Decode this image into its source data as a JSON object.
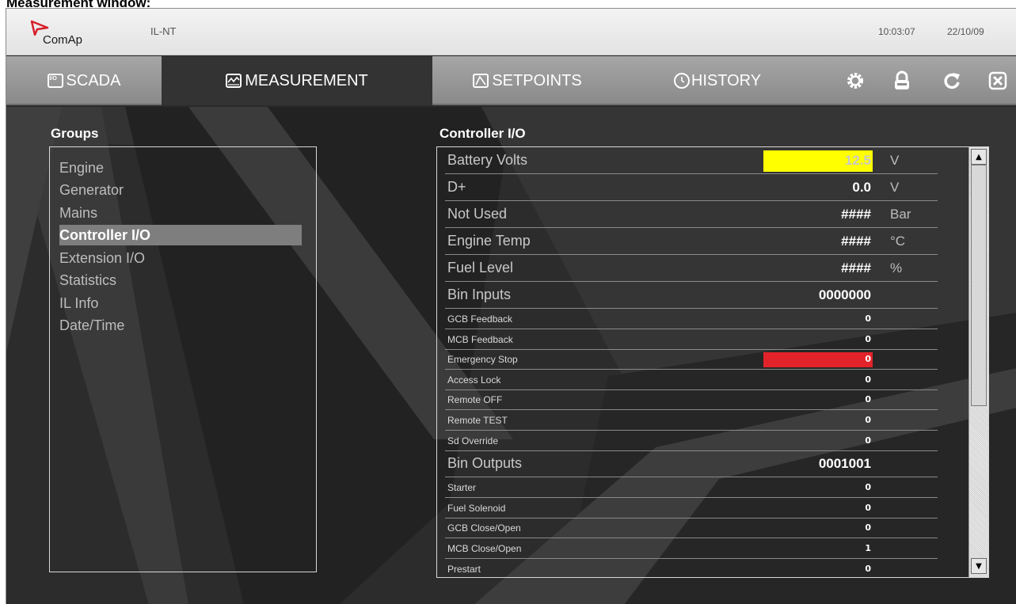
{
  "caption": "Measurement window:",
  "header": {
    "brand": "ComAp",
    "device": "IL-NT",
    "time": "10:03:07",
    "date": "22/10/09"
  },
  "tabs": [
    {
      "label": "SCADA",
      "icon": "scada-icon"
    },
    {
      "label": "MEASUREMENT",
      "icon": "measurement-icon",
      "active": true
    },
    {
      "label": "SETPOINTS",
      "icon": "setpoints-icon"
    },
    {
      "label": "HISTORY",
      "icon": "history-icon"
    }
  ],
  "toolbar": [
    "settings-gear-icon",
    "lock-icon",
    "refresh-icon",
    "close-icon"
  ],
  "groups": {
    "title": "Groups",
    "items": [
      "Engine",
      "Generator",
      "Mains",
      "Controller I/O",
      "Extension I/O",
      "Statistics",
      "IL Info",
      "Date/Time"
    ],
    "selected": "Controller I/O"
  },
  "io": {
    "title": "Controller I/O",
    "rows": [
      {
        "label": "Battery Volts",
        "value": "12.5",
        "unit": "V",
        "highlight": "#ffff00",
        "valueColor": "#c8c8c8"
      },
      {
        "label": "D+",
        "value": "0.0",
        "unit": "V"
      },
      {
        "label": "Not Used",
        "value": "####",
        "unit": "Bar"
      },
      {
        "label": "Engine Temp",
        "value": "####",
        "unit": "°C"
      },
      {
        "label": "Fuel Level",
        "value": "####",
        "unit": "%"
      },
      {
        "label": "Bin Inputs",
        "value": "0000000",
        "unit": ""
      },
      {
        "label": "GCB Feedback",
        "value": "0"
      },
      {
        "label": "MCB Feedback",
        "value": "0"
      },
      {
        "label": "Emergency Stop",
        "value": "0",
        "highlight": "#e3232a"
      },
      {
        "label": "Access Lock",
        "value": "0"
      },
      {
        "label": "Remote OFF",
        "value": "0"
      },
      {
        "label": "Remote TEST",
        "value": "0"
      },
      {
        "label": "Sd Override",
        "value": "0"
      },
      {
        "label": "Bin Outputs",
        "value": "0001001",
        "unit": ""
      },
      {
        "label": "Starter",
        "value": "0"
      },
      {
        "label": "Fuel Solenoid",
        "value": "0"
      },
      {
        "label": "GCB Close/Open",
        "value": "0"
      },
      {
        "label": "MCB Close/Open",
        "value": "1"
      },
      {
        "label": "Prestart",
        "value": "0"
      }
    ]
  }
}
